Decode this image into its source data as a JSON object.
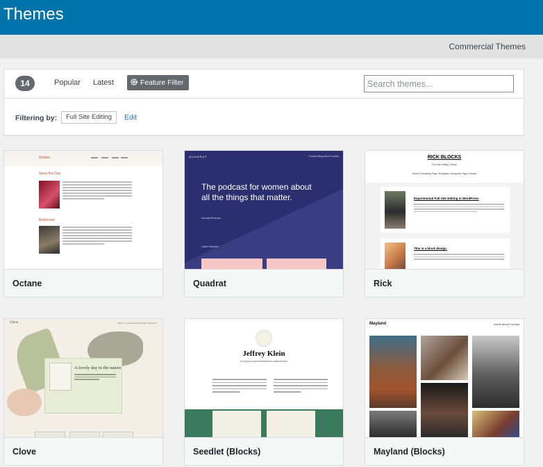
{
  "header": {
    "title": "Themes"
  },
  "subnav": {
    "commercial_link": "Commercial Themes"
  },
  "filter_bar": {
    "count": "14",
    "tabs": [
      "Popular",
      "Latest"
    ],
    "feature_filter_label": "Feature Filter",
    "search_placeholder": "Search themes..."
  },
  "filtering": {
    "label": "Filtering by:",
    "tags": [
      "Full Site Editing"
    ],
    "edit_label": "Edit"
  },
  "themes": [
    {
      "name": "Octane"
    },
    {
      "name": "Quadrat"
    },
    {
      "name": "Rick"
    },
    {
      "name": "Clove"
    },
    {
      "name": "Seedlet (Blocks)"
    },
    {
      "name": "Mayland (Blocks)"
    }
  ],
  "previews": {
    "octane": {
      "logo": "Octane",
      "post1_title": "Seize the Day",
      "post2_title": "Bedrooms"
    },
    "quadrat": {
      "logo": "QUADRAT",
      "menu": "Podcast  Blog  About  Contact",
      "headline": "The podcast for women about all the things that matter.",
      "tagline": "#CreativePodcast",
      "latest": "Latest Episodes"
    },
    "rick": {
      "logo": "RICK BLOCKS",
      "subtitle": "Full Site Editing Theme",
      "nav": "Home  Formatting  Page Templates  Categories  Tags  Contact",
      "post1_title": "Experimental Full Site Editing in WordPress",
      "post2_title": "This is a block design."
    },
    "clove": {
      "logo": "Clove",
      "nav": "ABOUT  COLLECTIONS  SHOP  CONTACT",
      "box_title": "A lovely day in the nature"
    },
    "seedlet": {
      "title": "Jeffrey Klein",
      "subtitle": "is using an experimental block-based theme"
    },
    "mayland": {
      "logo": "Mayland",
      "nav": "Home  About  Contact"
    }
  },
  "colors": {
    "header_bg": "#0073aa",
    "accent": "#2271b1",
    "badge_bg": "#646970"
  },
  "icons": {
    "feature_filter": "gear-icon"
  }
}
